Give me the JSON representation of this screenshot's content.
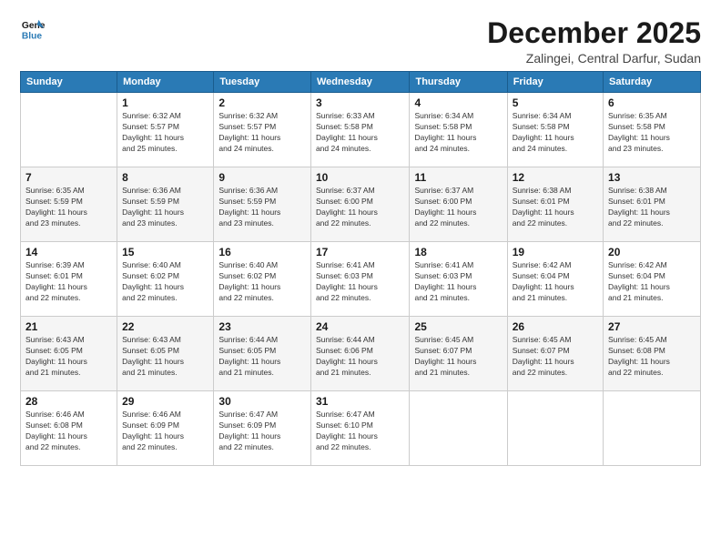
{
  "logo": {
    "line1": "General",
    "line2": "Blue"
  },
  "title": "December 2025",
  "location": "Zalingei, Central Darfur, Sudan",
  "days_header": [
    "Sunday",
    "Monday",
    "Tuesday",
    "Wednesday",
    "Thursday",
    "Friday",
    "Saturday"
  ],
  "weeks": [
    [
      {
        "num": "",
        "info": ""
      },
      {
        "num": "1",
        "info": "Sunrise: 6:32 AM\nSunset: 5:57 PM\nDaylight: 11 hours\nand 25 minutes."
      },
      {
        "num": "2",
        "info": "Sunrise: 6:32 AM\nSunset: 5:57 PM\nDaylight: 11 hours\nand 24 minutes."
      },
      {
        "num": "3",
        "info": "Sunrise: 6:33 AM\nSunset: 5:58 PM\nDaylight: 11 hours\nand 24 minutes."
      },
      {
        "num": "4",
        "info": "Sunrise: 6:34 AM\nSunset: 5:58 PM\nDaylight: 11 hours\nand 24 minutes."
      },
      {
        "num": "5",
        "info": "Sunrise: 6:34 AM\nSunset: 5:58 PM\nDaylight: 11 hours\nand 24 minutes."
      },
      {
        "num": "6",
        "info": "Sunrise: 6:35 AM\nSunset: 5:58 PM\nDaylight: 11 hours\nand 23 minutes."
      }
    ],
    [
      {
        "num": "7",
        "info": "Sunrise: 6:35 AM\nSunset: 5:59 PM\nDaylight: 11 hours\nand 23 minutes."
      },
      {
        "num": "8",
        "info": "Sunrise: 6:36 AM\nSunset: 5:59 PM\nDaylight: 11 hours\nand 23 minutes."
      },
      {
        "num": "9",
        "info": "Sunrise: 6:36 AM\nSunset: 5:59 PM\nDaylight: 11 hours\nand 23 minutes."
      },
      {
        "num": "10",
        "info": "Sunrise: 6:37 AM\nSunset: 6:00 PM\nDaylight: 11 hours\nand 22 minutes."
      },
      {
        "num": "11",
        "info": "Sunrise: 6:37 AM\nSunset: 6:00 PM\nDaylight: 11 hours\nand 22 minutes."
      },
      {
        "num": "12",
        "info": "Sunrise: 6:38 AM\nSunset: 6:01 PM\nDaylight: 11 hours\nand 22 minutes."
      },
      {
        "num": "13",
        "info": "Sunrise: 6:38 AM\nSunset: 6:01 PM\nDaylight: 11 hours\nand 22 minutes."
      }
    ],
    [
      {
        "num": "14",
        "info": "Sunrise: 6:39 AM\nSunset: 6:01 PM\nDaylight: 11 hours\nand 22 minutes."
      },
      {
        "num": "15",
        "info": "Sunrise: 6:40 AM\nSunset: 6:02 PM\nDaylight: 11 hours\nand 22 minutes."
      },
      {
        "num": "16",
        "info": "Sunrise: 6:40 AM\nSunset: 6:02 PM\nDaylight: 11 hours\nand 22 minutes."
      },
      {
        "num": "17",
        "info": "Sunrise: 6:41 AM\nSunset: 6:03 PM\nDaylight: 11 hours\nand 22 minutes."
      },
      {
        "num": "18",
        "info": "Sunrise: 6:41 AM\nSunset: 6:03 PM\nDaylight: 11 hours\nand 21 minutes."
      },
      {
        "num": "19",
        "info": "Sunrise: 6:42 AM\nSunset: 6:04 PM\nDaylight: 11 hours\nand 21 minutes."
      },
      {
        "num": "20",
        "info": "Sunrise: 6:42 AM\nSunset: 6:04 PM\nDaylight: 11 hours\nand 21 minutes."
      }
    ],
    [
      {
        "num": "21",
        "info": "Sunrise: 6:43 AM\nSunset: 6:05 PM\nDaylight: 11 hours\nand 21 minutes."
      },
      {
        "num": "22",
        "info": "Sunrise: 6:43 AM\nSunset: 6:05 PM\nDaylight: 11 hours\nand 21 minutes."
      },
      {
        "num": "23",
        "info": "Sunrise: 6:44 AM\nSunset: 6:05 PM\nDaylight: 11 hours\nand 21 minutes."
      },
      {
        "num": "24",
        "info": "Sunrise: 6:44 AM\nSunset: 6:06 PM\nDaylight: 11 hours\nand 21 minutes."
      },
      {
        "num": "25",
        "info": "Sunrise: 6:45 AM\nSunset: 6:07 PM\nDaylight: 11 hours\nand 21 minutes."
      },
      {
        "num": "26",
        "info": "Sunrise: 6:45 AM\nSunset: 6:07 PM\nDaylight: 11 hours\nand 22 minutes."
      },
      {
        "num": "27",
        "info": "Sunrise: 6:45 AM\nSunset: 6:08 PM\nDaylight: 11 hours\nand 22 minutes."
      }
    ],
    [
      {
        "num": "28",
        "info": "Sunrise: 6:46 AM\nSunset: 6:08 PM\nDaylight: 11 hours\nand 22 minutes."
      },
      {
        "num": "29",
        "info": "Sunrise: 6:46 AM\nSunset: 6:09 PM\nDaylight: 11 hours\nand 22 minutes."
      },
      {
        "num": "30",
        "info": "Sunrise: 6:47 AM\nSunset: 6:09 PM\nDaylight: 11 hours\nand 22 minutes."
      },
      {
        "num": "31",
        "info": "Sunrise: 6:47 AM\nSunset: 6:10 PM\nDaylight: 11 hours\nand 22 minutes."
      },
      {
        "num": "",
        "info": ""
      },
      {
        "num": "",
        "info": ""
      },
      {
        "num": "",
        "info": ""
      }
    ]
  ]
}
